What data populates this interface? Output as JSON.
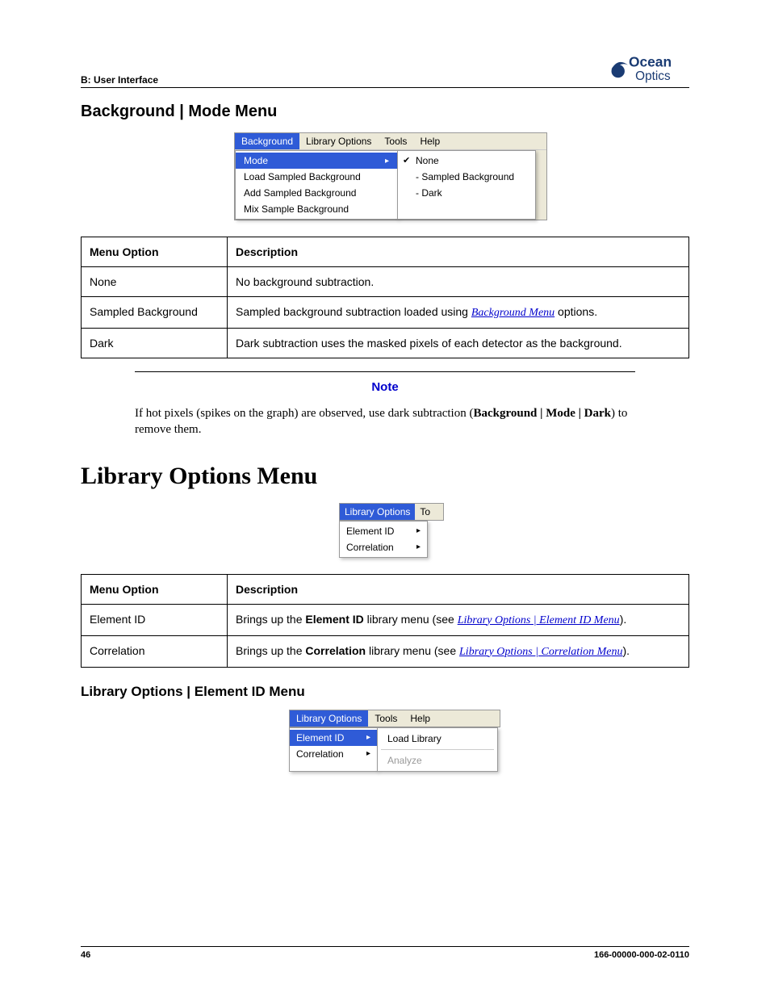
{
  "header": {
    "breadcrumb": "B: User Interface",
    "logo_top": "Ocean",
    "logo_bottom": "Optics"
  },
  "section1": {
    "title": "Background | Mode Menu",
    "fig": {
      "menubar": [
        "Background",
        "Library Options",
        "Tools",
        "Help"
      ],
      "dd_left": [
        "Mode",
        "Load Sampled Background",
        "Add Sampled Background",
        "Mix Sample Background"
      ],
      "dd_right": [
        "None",
        "- Sampled Background",
        "- Dark"
      ]
    },
    "table": {
      "head": [
        "Menu Option",
        "Description"
      ],
      "rows": [
        {
          "opt": "None",
          "desc": "No background subtraction."
        },
        {
          "opt": "Sampled Background",
          "desc_pre": "Sampled background subtraction loaded using ",
          "link": "Background Menu",
          "desc_post": " options."
        },
        {
          "opt": "Dark",
          "desc": "Dark subtraction uses the masked pixels of each detector as the background."
        }
      ]
    },
    "note": {
      "title": "Note",
      "pre": "If hot pixels (spikes on the graph) are observed, use dark subtraction (",
      "bold": "Background | Mode | Dark",
      "post": ") to remove them."
    }
  },
  "section2": {
    "title": "Library Options Menu",
    "fig": {
      "menubar": [
        "Library Options",
        "To"
      ],
      "dd": [
        "Element ID",
        "Correlation"
      ]
    },
    "table": {
      "head": [
        "Menu Option",
        "Description"
      ],
      "rows": [
        {
          "opt": "Element ID",
          "pre": "Brings up the ",
          "bold": "Element ID",
          "mid": " library menu (see ",
          "link": "Library Options | Element ID Menu",
          "post": ")."
        },
        {
          "opt": "Correlation",
          "pre": "Brings up the ",
          "bold": "Correlation",
          "mid": " library menu (see ",
          "link": "Library Options | Correlation Menu",
          "post": ")."
        }
      ]
    }
  },
  "section3": {
    "title": "Library Options | Element ID Menu",
    "fig": {
      "menubar": [
        "Library Options",
        "Tools",
        "Help"
      ],
      "dd_left": [
        "Element ID",
        "Correlation"
      ],
      "dd_right": [
        "Load Library",
        "Analyze"
      ]
    }
  },
  "footer": {
    "page": "46",
    "docnum": "166-00000-000-02-0110"
  }
}
